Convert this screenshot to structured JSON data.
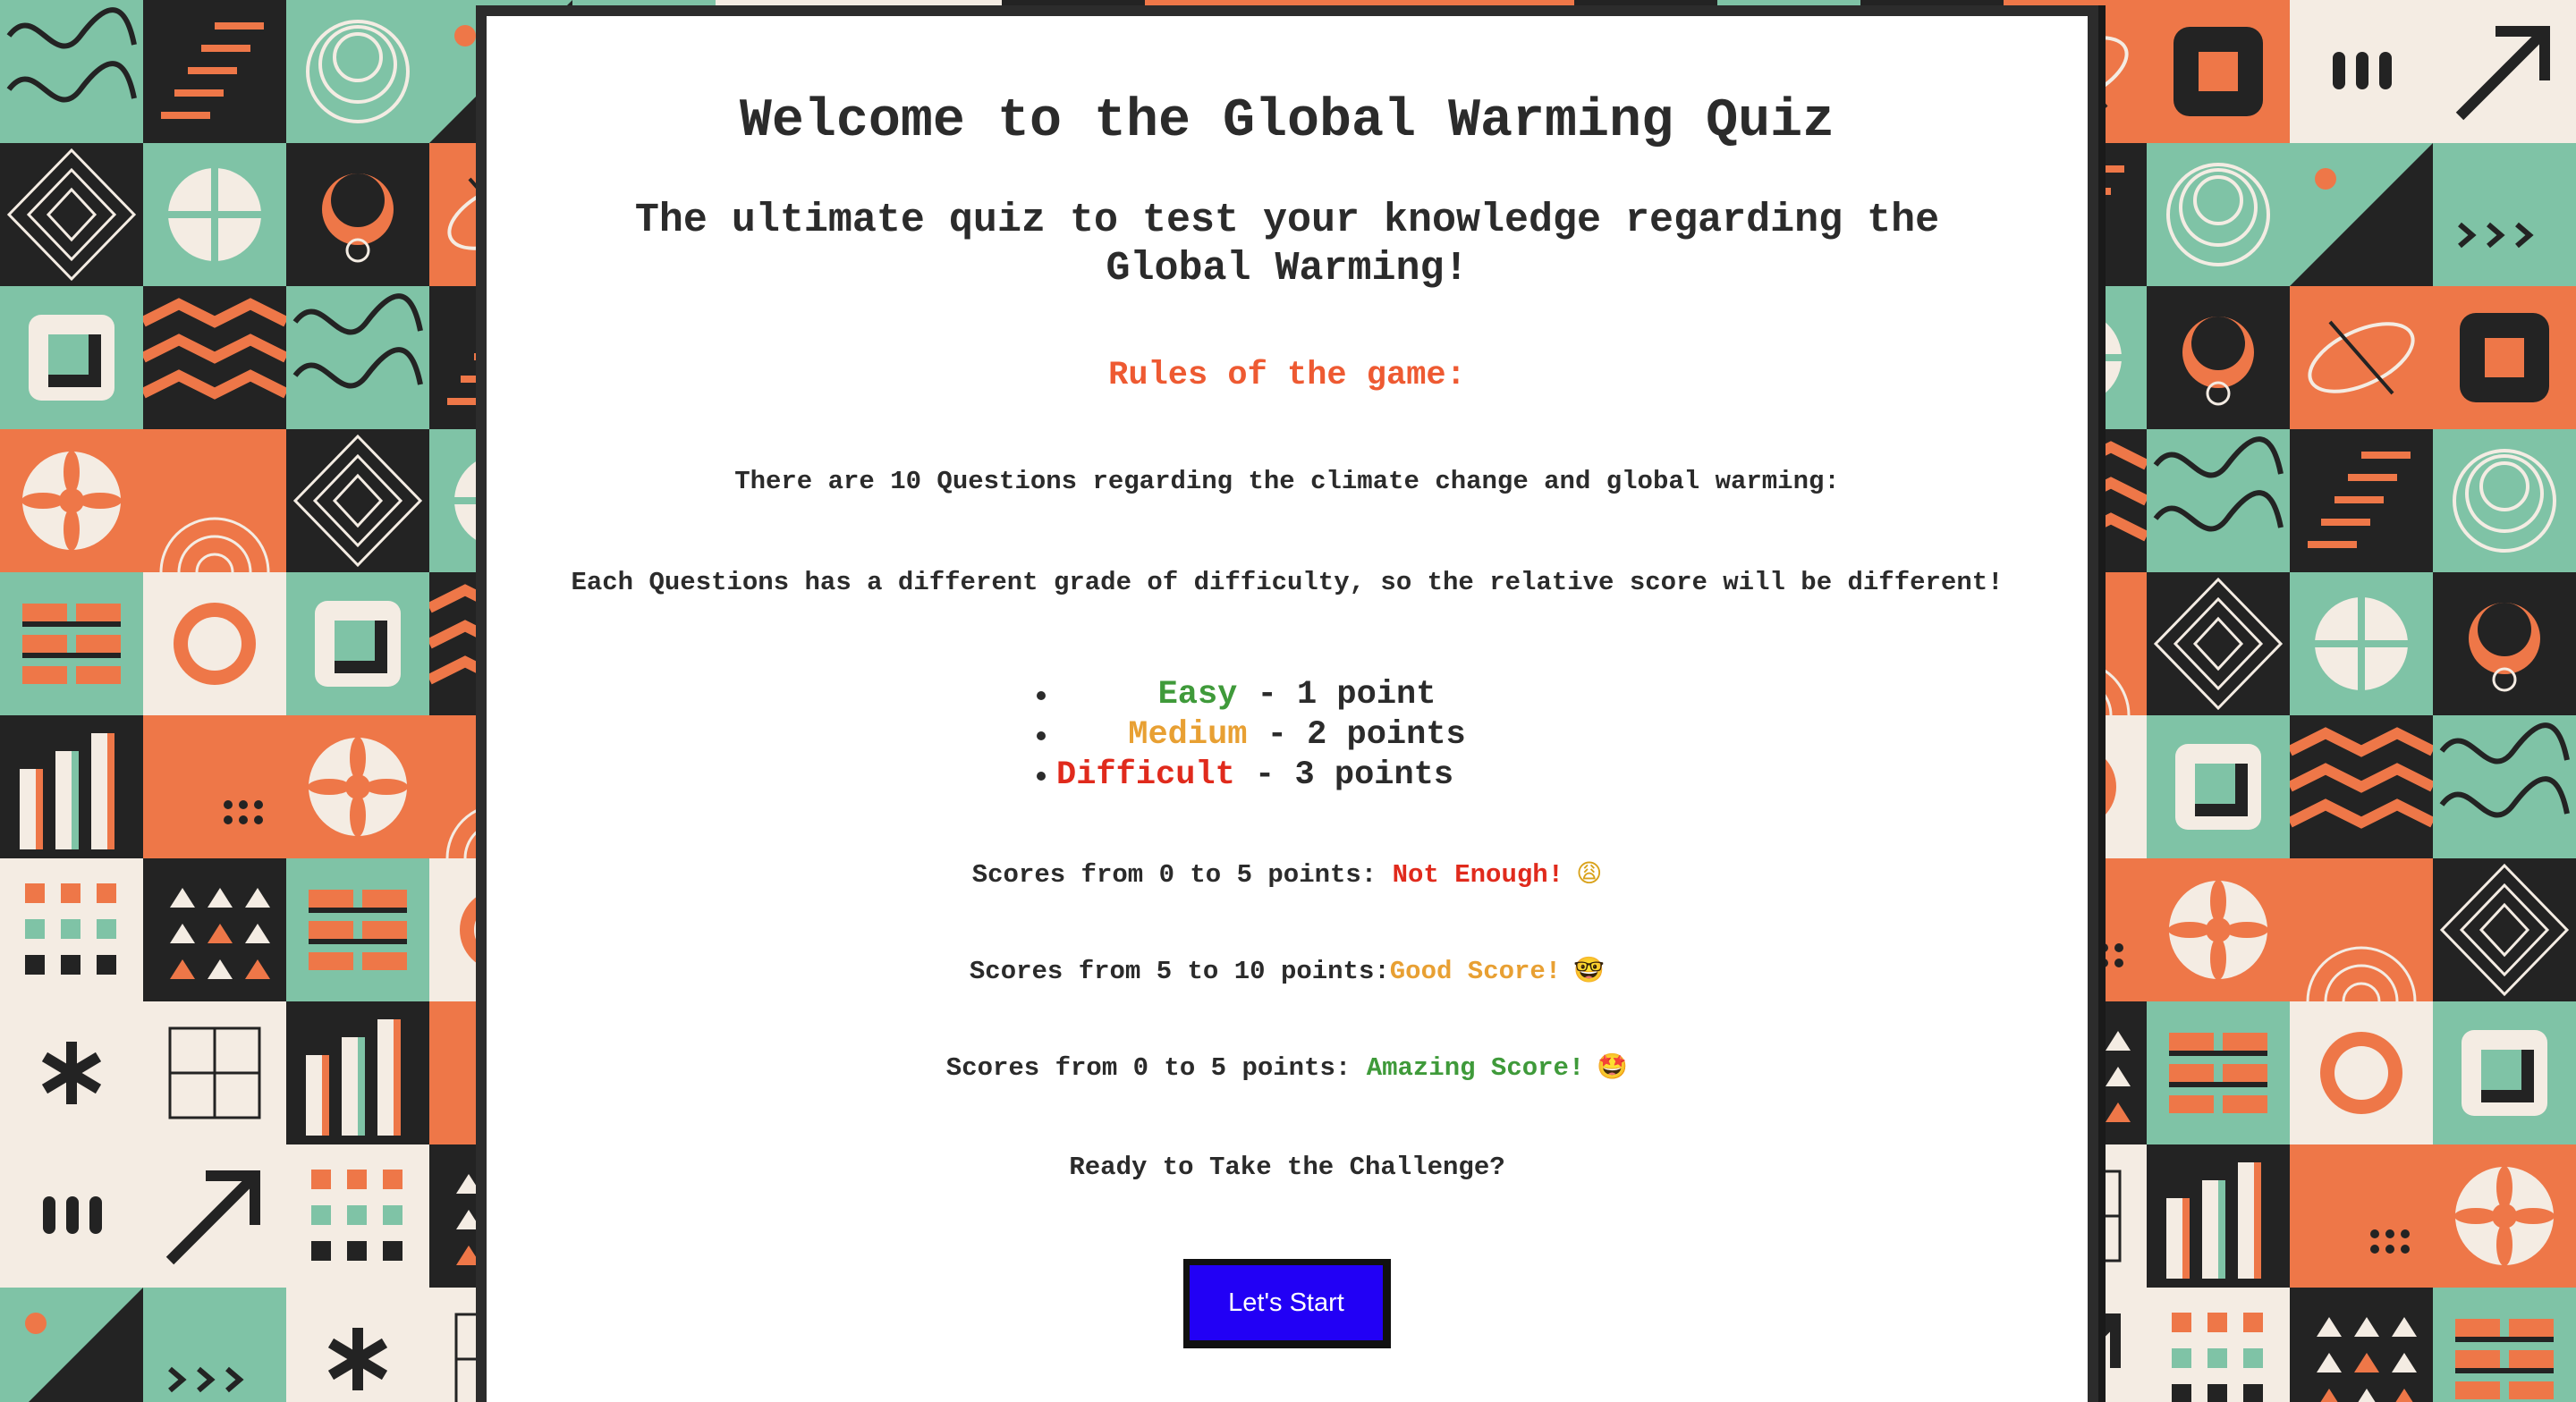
{
  "page": {
    "title": "Welcome to the Global Warming Quiz",
    "subtitle": "The ultimate quiz to test your knowledge regarding the Global Warming!",
    "rules_heading": "Rules of the game:",
    "rule_questions": "There are 10 Questions regarding the climate change and global warming:",
    "rule_difficulty": "Each Questions has a different grade of difficulty, so the relative score will be different!",
    "levels": [
      {
        "name": "Easy",
        "points": " - 1 point"
      },
      {
        "name": "Medium",
        "points": " - 2 points"
      },
      {
        "name": "Difficult",
        "points": " - 3 points"
      }
    ],
    "scores": [
      {
        "prefix": "Scores from 0 to 5 points: ",
        "verdict": "Not Enough!",
        "emoji": "😩"
      },
      {
        "prefix": "Scores from 5 to 10 points:",
        "verdict": "Good Score!",
        "emoji": "🤓"
      },
      {
        "prefix": "Scores from 0 to 5 points: ",
        "verdict": "Amazing Score!",
        "emoji": "🤩"
      }
    ],
    "ready": "Ready to Take the Challenge?",
    "start_button": "Let's Start"
  },
  "colors": {
    "accent_orange": "#ee5a32",
    "easy": "#3f9a3a",
    "medium": "#e8a033",
    "difficult": "#e02a1c",
    "button": "#2200f5",
    "tile_orange": "#ee7748",
    "tile_mint": "#7fc3a6",
    "tile_cream": "#f4ece3",
    "tile_dark": "#232323"
  }
}
